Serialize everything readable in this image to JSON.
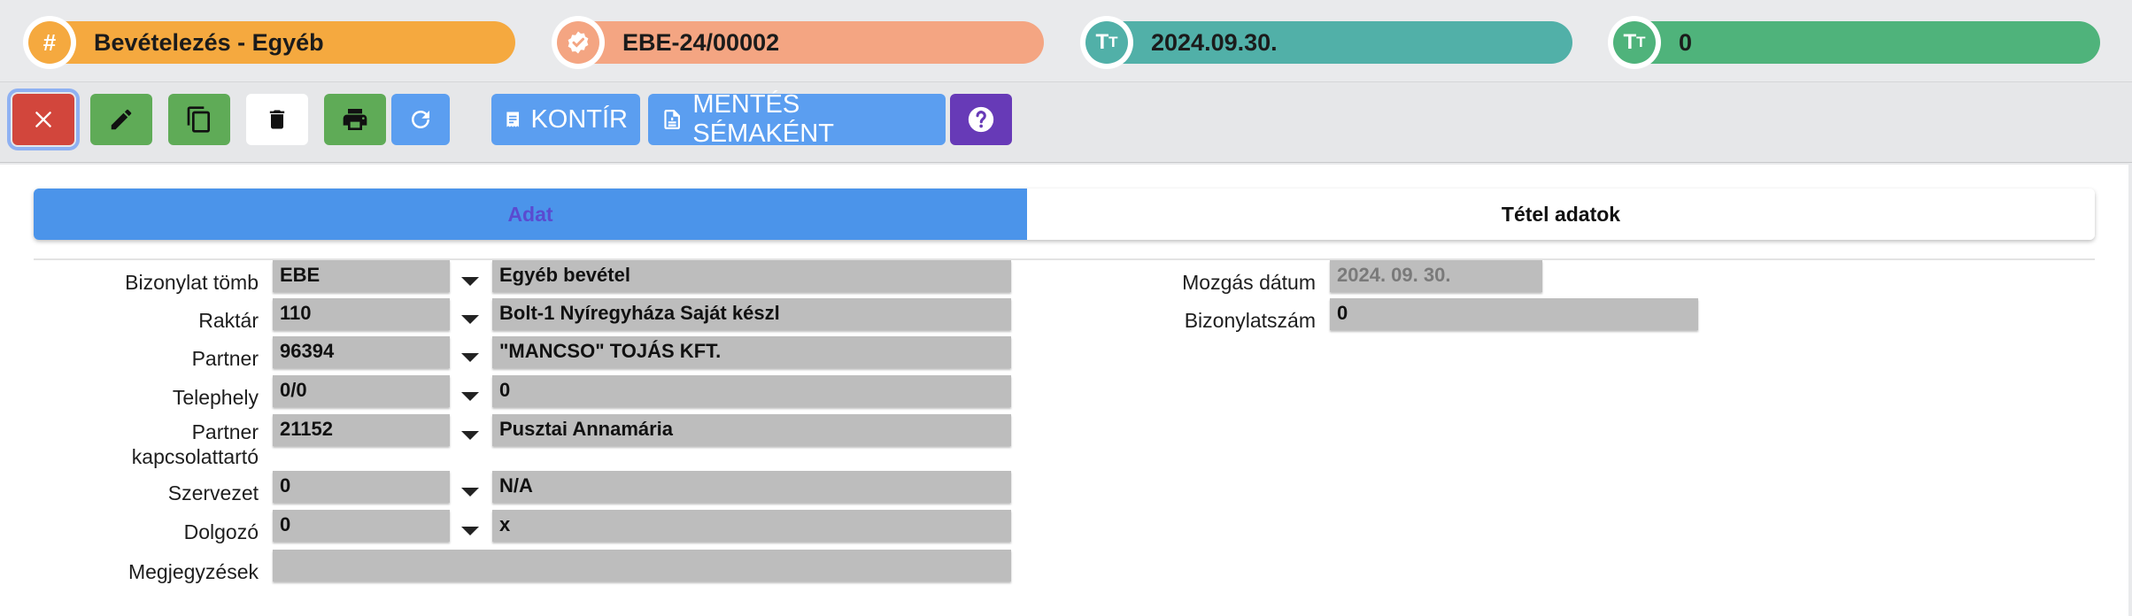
{
  "header": {
    "doc_type": "Bevételezés - Egyéb",
    "doc_number": "EBE-24/00002",
    "date": "2024.09.30.",
    "count": "0",
    "colors": {
      "orange": "#f5a93f",
      "salmon": "#f4a582",
      "teal": "#51b0a8",
      "green": "#4fb37b"
    },
    "icons": [
      "hash-icon",
      "check-badge-icon",
      "text-icon",
      "text-icon"
    ]
  },
  "toolbar": {
    "close_icon": "close-icon",
    "edit_icon": "pencil-icon",
    "copy_icon": "copy-icon",
    "delete_icon": "trash-icon",
    "print_icon": "printer-icon",
    "refresh_icon": "refresh-icon",
    "kontir_label": "KONTÍR",
    "save_template_label": "MENTÉS SÉMAKÉNT",
    "help_icon": "help-icon"
  },
  "tabs": [
    {
      "label": "Adat",
      "active": true
    },
    {
      "label": "Tétel adatok",
      "active": false
    }
  ],
  "form": {
    "bizonylat_tomb": {
      "label": "Bizonylat tömb",
      "code": "EBE",
      "name": "Egyéb bevétel"
    },
    "raktar": {
      "label": "Raktár",
      "code": "110",
      "name": "Bolt-1 Nyíregyháza Saját készl"
    },
    "partner": {
      "label": "Partner",
      "code": "96394",
      "name": "\"MANCSO\" TOJÁS KFT."
    },
    "telephely": {
      "label": "Telephely",
      "code": "0/0",
      "name": "0"
    },
    "kapcsolattarto": {
      "label_line1": "Partner",
      "label_line2": "kapcsolattartó",
      "code": "21152",
      "name": "Pusztai Annamária"
    },
    "szervezet": {
      "label": "Szervezet",
      "code": "0",
      "name": "N/A"
    },
    "dolgozo": {
      "label": "Dolgozó",
      "code": "0",
      "name": "x"
    },
    "megjegyzesek": {
      "label": "Megjegyzések",
      "value": ""
    },
    "mozgas_datum": {
      "label": "Mozgás dátum",
      "value": "2024. 09. 30."
    },
    "bizonylatszam": {
      "label": "Bizonylatszám",
      "value": "0"
    }
  }
}
